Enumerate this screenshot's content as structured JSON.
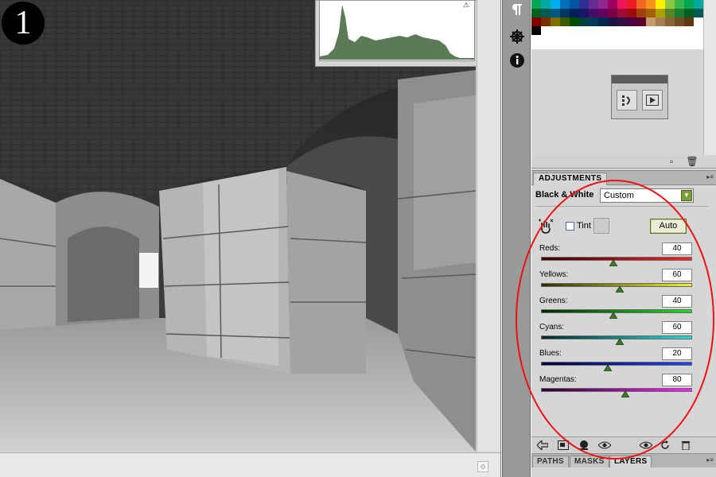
{
  "step": {
    "number": "1"
  },
  "adjustments": {
    "tab_label": "ADJUSTMENTS",
    "title": "Black & White",
    "preset": "Custom",
    "tint_label": "Tint",
    "tint_checked": false,
    "auto_label": "Auto",
    "sliders": [
      {
        "label": "Reds:",
        "value": "40",
        "color_from": "#3a0000",
        "color_to": "#ff2020"
      },
      {
        "label": "Yellows:",
        "value": "60",
        "color_from": "#2c2c00",
        "color_to": "#f0f020"
      },
      {
        "label": "Greens:",
        "value": "40",
        "color_from": "#002a00",
        "color_to": "#20e020"
      },
      {
        "label": "Cyans:",
        "value": "60",
        "color_from": "#002a2a",
        "color_to": "#20e0e0"
      },
      {
        "label": "Blues:",
        "value": "20",
        "color_from": "#00003a",
        "color_to": "#2040ff"
      },
      {
        "label": "Magentas:",
        "value": "80",
        "color_from": "#2a002a",
        "color_to": "#ff20ff"
      }
    ],
    "slider_min": -200,
    "slider_max": 300
  },
  "bottom_tabs": [
    {
      "label": "PATHS",
      "active": false
    },
    {
      "label": "MASKS",
      "active": false
    },
    {
      "label": "LAYERS",
      "active": true
    }
  ],
  "colors": {
    "highlight": "#e11111",
    "histogram_fill": "#5c7a58",
    "auto_border": "#5a7020"
  },
  "swatches": [
    "#00a651",
    "#00a99d",
    "#00aeef",
    "#0072bc",
    "#0054a6",
    "#2e3192",
    "#662d91",
    "#92278f",
    "#9e005d",
    "#ed145b",
    "#ed1c24",
    "#f26522",
    "#f7941d",
    "#fff200",
    "#8dc63f",
    "#39b54a",
    "#00a651",
    "#00a99d",
    "#005e20",
    "#005952",
    "#00587c",
    "#003663",
    "#002157",
    "#1b1464",
    "#440e62",
    "#630460",
    "#7b0046",
    "#9e0b39",
    "#9e0b0f",
    "#a0410d",
    "#a36209",
    "#aba000",
    "#598527",
    "#197b30",
    "#005e20",
    "#005952",
    "#7f0000",
    "#7b2e00",
    "#7b6f00",
    "#3d5b00",
    "#004d00",
    "#00413d",
    "#003a5a",
    "#00274e",
    "#1a1446",
    "#2e1046",
    "#4b0042",
    "#5c002e",
    "#c69c6d",
    "#a67c52",
    "#8c6239",
    "#754c24",
    "#603913",
    "#fff",
    "#000"
  ],
  "icons": {
    "dock": [
      "paragraph-icon",
      "navigator-icon",
      "info-icon"
    ],
    "footer": [
      "back-arrow-icon",
      "expand-view-icon",
      "clip-layer-icon",
      "visibility-eye-icon",
      "previous-state-icon",
      "reset-icon",
      "trash-icon"
    ]
  }
}
